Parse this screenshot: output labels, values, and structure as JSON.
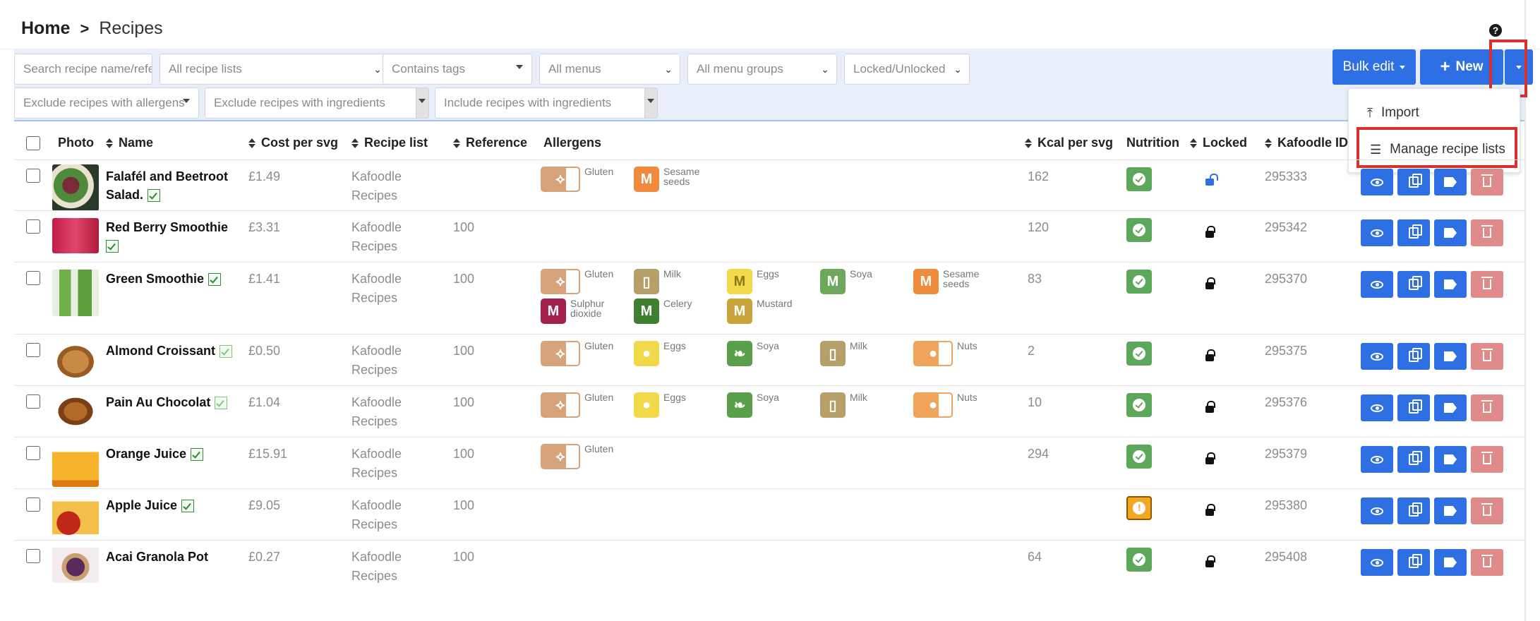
{
  "breadcrumb": {
    "home": "Home",
    "separator": ">",
    "current": "Recipes"
  },
  "filters": {
    "search_placeholder": "Search recipe name/refe",
    "recipe_lists": "All recipe lists",
    "tags": "Contains tags",
    "menus": "All menus",
    "menu_groups": "All menu groups",
    "locked": "Locked/Unlocked",
    "exclude_allergens": "Exclude recipes with allergens",
    "exclude_ingredients": "Exclude recipes with ingredients",
    "include_ingredients": "Include recipes with ingredients"
  },
  "toolbar": {
    "bulk_edit": "Bulk edit",
    "new": "New"
  },
  "menu": {
    "import": "Import",
    "manage_lists": "Manage recipe lists"
  },
  "columns": {
    "photo": "Photo",
    "name": "Name",
    "cost": "Cost per svg",
    "recipe_list": "Recipe list",
    "reference": "Reference",
    "allergens": "Allergens",
    "kcal": "Kcal per svg",
    "nutrition": "Nutrition",
    "locked": "Locked",
    "kafoodle_id": "Kafoodle ID"
  },
  "recipes": [
    {
      "name": "Falafél and Beetroot Salad.",
      "cost": "£1.49",
      "list1": "Kafoodle",
      "list2": "Recipes",
      "reference": "",
      "kcal": "162",
      "kafoodle_id": "295333",
      "allergens": [
        {
          "label": "Gluten",
          "color": "#d7a37b",
          "icon": "wheat-icon"
        },
        {
          "label": "Sesame seeds",
          "color": "#f08a3c",
          "icon": "m-icon"
        }
      ]
    },
    {
      "name": "Red Berry Smoothie",
      "cost": "£3.31",
      "list1": "Kafoodle",
      "list2": "Recipes",
      "reference": "100",
      "kcal": "120",
      "kafoodle_id": "295342",
      "allergens": []
    },
    {
      "name": "Green Smoothie",
      "cost": "£1.41",
      "list1": "Kafoodle",
      "list2": "Recipes",
      "reference": "100",
      "kcal": "83",
      "kafoodle_id": "295370",
      "allergens": [
        {
          "label": "Gluten",
          "color": "#d7a37b",
          "icon": "wheat-icon"
        },
        {
          "label": "Milk",
          "color": "#b5a06a",
          "icon": "milk-icon"
        },
        {
          "label": "Eggs",
          "color": "#f2d94a",
          "icon": "m-icon"
        },
        {
          "label": "Soya",
          "color": "#6fa85c",
          "icon": "m-icon"
        },
        {
          "label": "Sesame seeds",
          "color": "#f08a3c",
          "icon": "m-icon"
        },
        {
          "label": "Sulphur dioxide",
          "color": "#a3214a",
          "icon": "m-icon"
        },
        {
          "label": "Celery",
          "color": "#3f7f2f",
          "icon": "m-icon"
        },
        {
          "label": "Mustard",
          "color": "#c9a43a",
          "icon": "m-icon"
        }
      ]
    },
    {
      "name": "Almond Croissant",
      "cost": "£0.50",
      "list1": "Kafoodle",
      "list2": "Recipes",
      "reference": "100",
      "kcal": "2",
      "kafoodle_id": "295375",
      "allergens": [
        {
          "label": "Gluten",
          "color": "#d7a37b",
          "icon": "wheat-icon"
        },
        {
          "label": "Eggs",
          "color": "#f2d94a",
          "icon": "egg-icon"
        },
        {
          "label": "Soya",
          "color": "#5aa04a",
          "icon": "soya-icon"
        },
        {
          "label": "Milk",
          "color": "#b5a06a",
          "icon": "milk-icon"
        },
        {
          "label": "Nuts",
          "color": "#f0a35a",
          "icon": "nuts-icon"
        }
      ]
    },
    {
      "name": "Pain Au Chocolat",
      "cost": "£1.04",
      "list1": "Kafoodle",
      "list2": "Recipes",
      "reference": "100",
      "kcal": "10",
      "kafoodle_id": "295376",
      "allergens": [
        {
          "label": "Gluten",
          "color": "#d7a37b",
          "icon": "wheat-icon"
        },
        {
          "label": "Eggs",
          "color": "#f2d94a",
          "icon": "egg-icon"
        },
        {
          "label": "Soya",
          "color": "#5aa04a",
          "icon": "soya-icon"
        },
        {
          "label": "Milk",
          "color": "#b5a06a",
          "icon": "milk-icon"
        },
        {
          "label": "Nuts",
          "color": "#f0a35a",
          "icon": "nuts-icon"
        }
      ]
    },
    {
      "name": "Orange Juice",
      "cost": "£15.91",
      "list1": "Kafoodle",
      "list2": "Recipes",
      "reference": "100",
      "kcal": "294",
      "kafoodle_id": "295379",
      "allergens": [
        {
          "label": "Gluten",
          "color": "#d7a37b",
          "icon": "wheat-icon"
        }
      ]
    },
    {
      "name": "Apple Juice",
      "cost": "£9.05",
      "list1": "Kafoodle",
      "list2": "Recipes",
      "reference": "100",
      "kcal": "",
      "kafoodle_id": "295380",
      "allergens": []
    },
    {
      "name": "Acai Granola Pot",
      "cost": "£0.27",
      "list1": "Kafoodle",
      "list2": "Recipes",
      "reference": "100",
      "kcal": "64",
      "kafoodle_id": "295408",
      "allergens": []
    }
  ]
}
